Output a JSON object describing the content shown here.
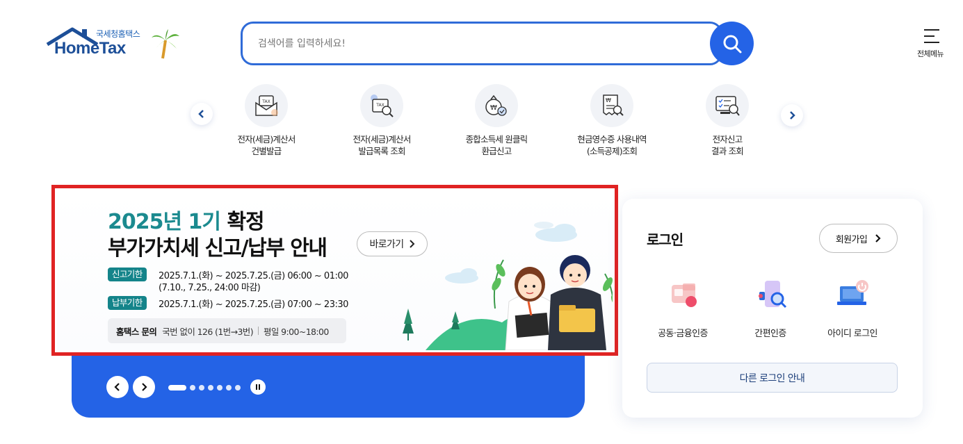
{
  "header": {
    "logo_ko": "국세청홈택스",
    "logo_en": "HomeTax",
    "search_placeholder": "검색어를 입력하세요!",
    "menu_label": "전체메뉴"
  },
  "quick_menu": {
    "items": [
      {
        "line1": "전자(세금)계산서",
        "line2": "건별발급",
        "icon": "tax-envelope-icon"
      },
      {
        "line1": "전자(세금)계산서",
        "line2": "발급목록 조회",
        "icon": "tax-search-icon"
      },
      {
        "line1": "종합소득세 원클릭",
        "line2": "환급신고",
        "icon": "money-bag-icon"
      },
      {
        "line1": "현금영수증 사용내역",
        "line2": "(소득공제)조회",
        "icon": "receipt-search-icon"
      },
      {
        "line1": "전자신고",
        "line2": "결과 조회",
        "icon": "checklist-search-icon"
      }
    ]
  },
  "banner": {
    "title_year": "2025년 1기",
    "title_rest": " 확정",
    "title_line2": "부가가치세 신고/납부 안내",
    "go_label": "바로가기",
    "report_tag": "신고기한",
    "report_line1": "2025.7.1.(화) ~ 2025.7.25.(금) 06:00 ~ 01:00",
    "report_line2": "(7.10., 7.25., 24:00 마감)",
    "pay_tag": "납부기한",
    "pay_line": "2025.7.1.(화) ~ 2025.7.25.(금) 07:00 ~ 23:30",
    "inquiry_label": "홈택스 문의",
    "inquiry_phone": "국번 없이 126 (1번→3번)",
    "inquiry_hours": "평일 9:00~18:00"
  },
  "slider": {
    "total": 7,
    "active_index": 0
  },
  "login": {
    "title": "로그인",
    "join_label": "회원가입",
    "options": [
      {
        "label": "공동·금융인증",
        "icon": "certificate-icon"
      },
      {
        "label": "간편인증",
        "icon": "phone-auth-icon"
      },
      {
        "label": "아이디 로그인",
        "icon": "id-login-icon"
      }
    ],
    "other_label": "다른 로그인 안내"
  },
  "colors": {
    "brand_blue": "#2463e6",
    "teal": "#14848a",
    "highlight_red": "#e02323"
  }
}
